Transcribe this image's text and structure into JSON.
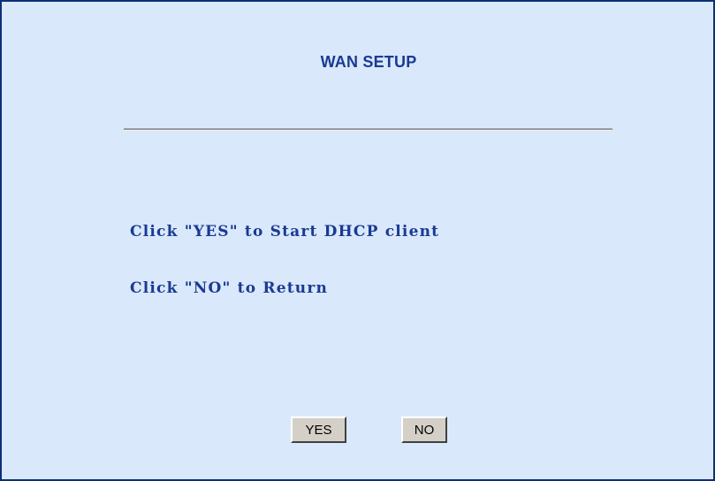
{
  "panel": {
    "title": "WAN SETUP",
    "instructions": [
      "Click \"YES\" to Start DHCP client",
      "Click \"NO\" to Return"
    ]
  },
  "buttons": {
    "yes_label": "YES",
    "no_label": "NO"
  },
  "colors": {
    "panel_background": "#d9e8fb",
    "panel_border": "#0c2f78",
    "text": "#1a3a92",
    "button_face": "#d4d0c8"
  }
}
